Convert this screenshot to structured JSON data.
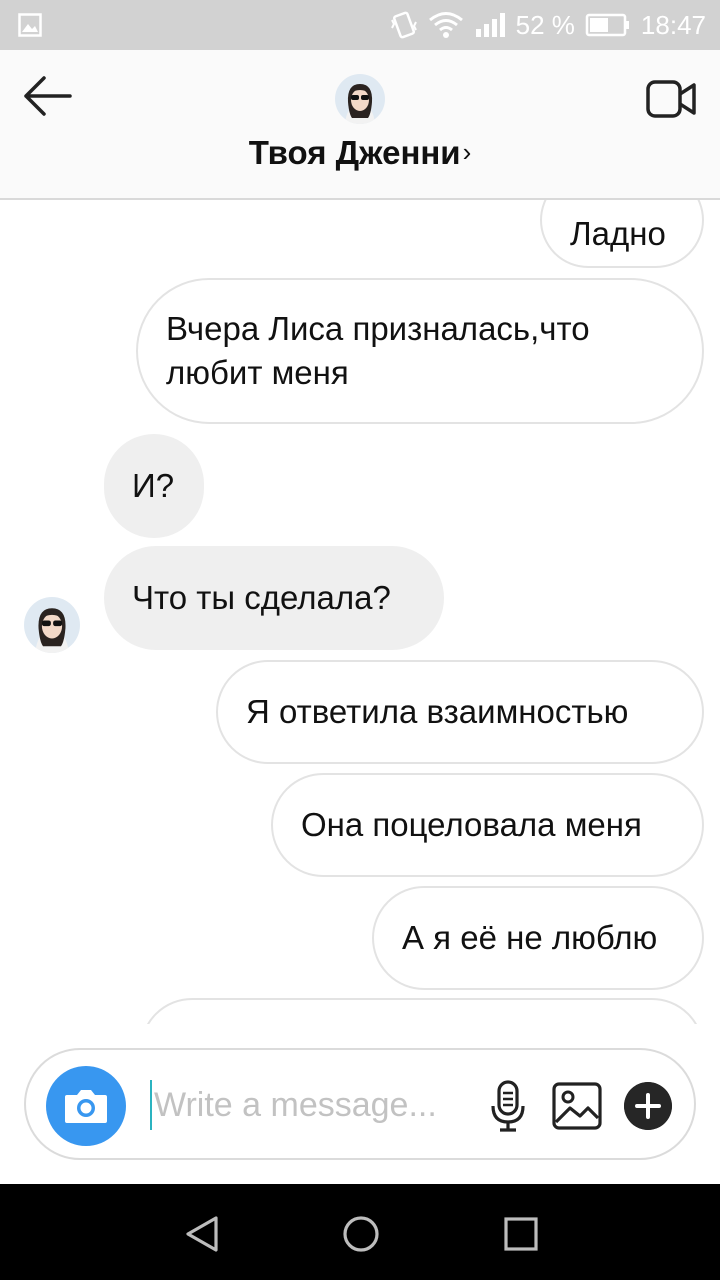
{
  "status_bar": {
    "battery_percent": "52 %",
    "time": "18:47",
    "icons": [
      "gallery-icon",
      "vibrate-icon",
      "wifi-icon",
      "signal-icon",
      "battery-icon"
    ]
  },
  "header": {
    "contact_name": "Твоя Дженни",
    "chevron": "›",
    "icons": [
      "back-arrow-icon",
      "avatar",
      "video-call-icon"
    ]
  },
  "messages": [
    {
      "side": "out",
      "text": "Ладно"
    },
    {
      "side": "out",
      "text": "Вчера Лиса призналась,что любит меня"
    },
    {
      "side": "in",
      "text": "И?"
    },
    {
      "side": "in",
      "text": "Что ты сделала?"
    },
    {
      "side": "out",
      "text": "Я ответила взаимностью"
    },
    {
      "side": "out",
      "text": "Она поцеловала меня"
    },
    {
      "side": "out",
      "text": "А я её не люблю"
    }
  ],
  "composer": {
    "placeholder": "Write a message...",
    "value": "",
    "icons": [
      "camera-icon",
      "microphone-icon",
      "gallery-icon",
      "plus-icon"
    ],
    "accent_color": "#3897f0"
  },
  "nav_bar": {
    "icons": [
      "back-triangle-icon",
      "home-circle-icon",
      "recents-square-icon"
    ]
  }
}
